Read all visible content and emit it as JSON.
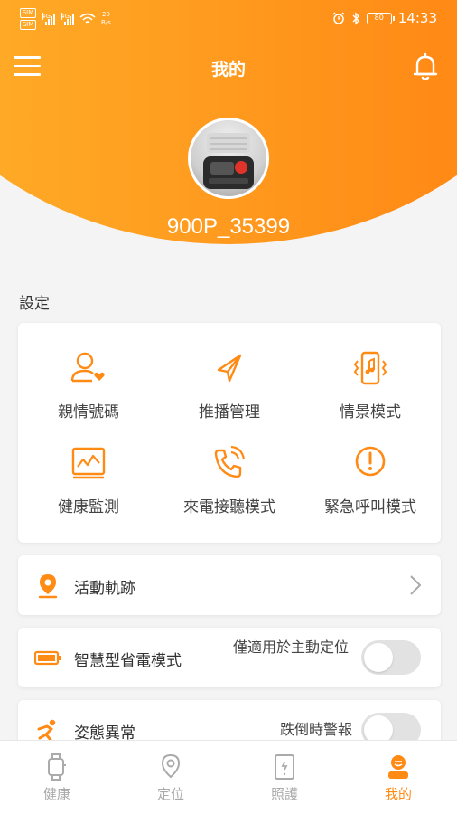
{
  "status_bar": {
    "sim1": "SIM",
    "sim2": "SIM",
    "network": "4G",
    "speed_value": "20",
    "speed_unit": "B/s",
    "battery": "80",
    "time": "14:33"
  },
  "header": {
    "title": "我的",
    "device_name": "900P_35399"
  },
  "settings": {
    "section_label": "設定",
    "grid": [
      {
        "label": "親情號碼",
        "icon": "family-contact-icon"
      },
      {
        "label": "推播管理",
        "icon": "paper-plane-icon"
      },
      {
        "label": "情景模式",
        "icon": "phone-vibrate-music-icon"
      },
      {
        "label": "健康監測",
        "icon": "heart-monitor-icon"
      },
      {
        "label": "來電接聽模式",
        "icon": "phone-call-icon"
      },
      {
        "label": "緊急呼叫模式",
        "icon": "alert-circle-icon"
      }
    ]
  },
  "rows": {
    "activity": {
      "label": "活動軌跡",
      "icon": "location-pin-icon"
    },
    "power_saving": {
      "label": "智慧型省電模式",
      "note": "僅適用於主動定位",
      "enabled": false,
      "icon": "battery-icon"
    },
    "posture": {
      "label": "姿態異常",
      "note": "跌倒時警報",
      "enabled": false,
      "icon": "falling-person-icon"
    }
  },
  "bottom_nav": [
    {
      "label": "健康",
      "icon": "watch-icon",
      "active": false
    },
    {
      "label": "定位",
      "icon": "location-icon",
      "active": false
    },
    {
      "label": "照護",
      "icon": "care-device-icon",
      "active": false
    },
    {
      "label": "我的",
      "icon": "user-profile-icon",
      "active": true
    }
  ],
  "colors": {
    "accent": "#ff8a14",
    "gradient_start": "#ffb22a",
    "gradient_end": "#ff8010",
    "toggle_off": "#e2e2e2"
  }
}
